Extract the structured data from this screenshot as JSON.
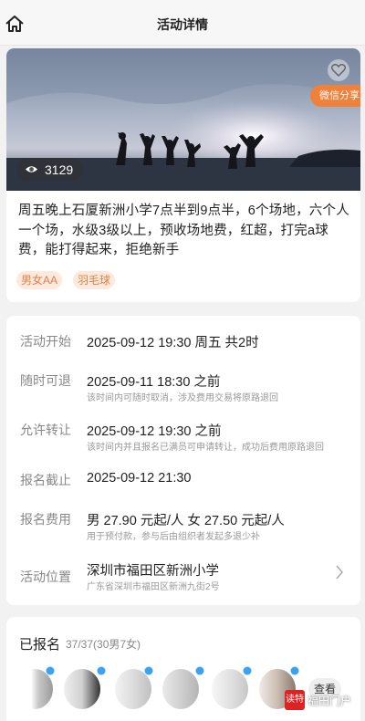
{
  "header": {
    "title": "活动详情",
    "home_icon": "home-icon"
  },
  "activity": {
    "views": "3129",
    "share_label": "微信分享",
    "description": "周五晚上石厦新洲小学7点半到9点半，6个场地，六个人一个场，水级3级以上，预收场地费，红超，打完a球费，能打得起来，拒绝新手",
    "tags": [
      "男女AA",
      "羽毛球"
    ],
    "accent_color": "#f0813a"
  },
  "details": [
    {
      "label": "活动开始",
      "value": "2025-09-12 19:30 周五  共2时",
      "note": ""
    },
    {
      "label": "随时可退",
      "value": "2025-09-11 18:30 之前",
      "note": "该时间内可随时取消，涉及费用交易将原路退回"
    },
    {
      "label": "允许转让",
      "value": "2025-09-12 19:30 之前",
      "note": "该时间内并且报名已满员可申请转让，成功后费用原路退回"
    },
    {
      "label": "报名截止",
      "value": "2025-09-12 21:30",
      "note": ""
    },
    {
      "label": "报名费用",
      "value": "男 27.90 元起/人   女 27.50 元起/人",
      "note": "用于预付款，参与后由组织者发起多退少补"
    },
    {
      "label": "活动位置",
      "value": "深圳市福田区新洲小学",
      "note": "广东省深圳市福田区新洲九街2号"
    }
  ],
  "registration": {
    "title": "已报名",
    "count": "37/37(30男7女)",
    "view_more_label": "查看"
  },
  "watermark": {
    "logo": "读特",
    "text": "福田门户"
  }
}
